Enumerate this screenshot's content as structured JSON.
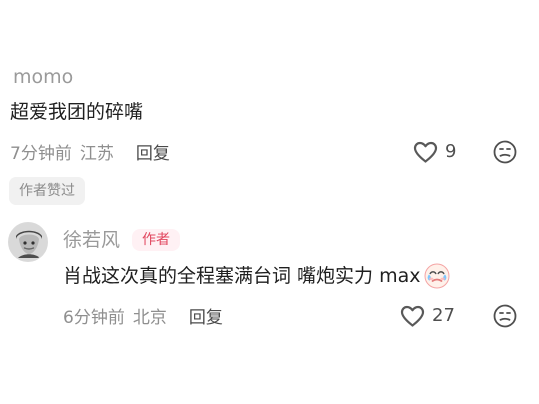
{
  "comment": {
    "username": "momo",
    "text": "超爱我团的碎嘴",
    "time": "7分钟前",
    "location": "江苏",
    "reply_label": "回复",
    "like_count": "9",
    "author_liked_label": "作者赞过"
  },
  "reply": {
    "username": "徐若风",
    "badge": "作者",
    "text": "肖战这次真的全程塞满台词 嘴炮实力 max",
    "time": "6分钟前",
    "location": "北京",
    "reply_label": "回复",
    "like_count": "27"
  },
  "icons": {
    "like": "heart-outline-icon",
    "dislike": "sad-face-icon",
    "reply_emoji": "crying-emoji-icon"
  },
  "colors": {
    "username": "#9a9a9a",
    "meta": "#8f8f8f",
    "author_badge_bg": "#fff1f4",
    "author_badge_text": "#e1475f",
    "pill_bg": "#f1f1f1"
  }
}
